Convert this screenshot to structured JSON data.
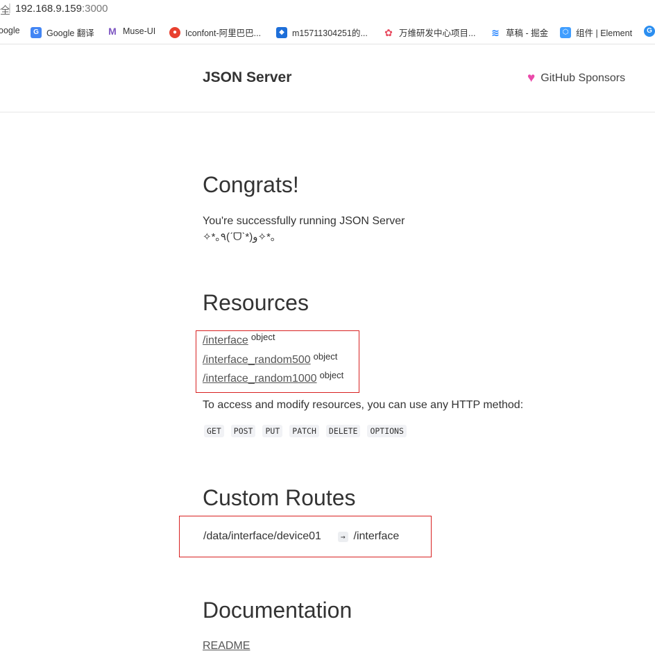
{
  "browser": {
    "security_label": "全",
    "url_host": "192.168.9.159",
    "url_port": ":3000",
    "bookmarks": [
      {
        "label": "oogle",
        "icon": "google-icon",
        "color": "#4285f4"
      },
      {
        "label": "Google 翻译",
        "icon": "google-translate-icon",
        "color": "#4285f4"
      },
      {
        "label": "Muse-UI",
        "icon": "muse-ui-icon",
        "color": "#7e57c2"
      },
      {
        "label": "Iconfont-阿里巴巴...",
        "icon": "iconfont-icon",
        "color": "#e8402f"
      },
      {
        "label": "m15711304251的...",
        "icon": "bookmark-app-icon",
        "color": "#1e6fd9"
      },
      {
        "label": "万维研发中心项目...",
        "icon": "flower-icon",
        "color": "#e84a5f"
      },
      {
        "label": "草稿 - 掘金",
        "icon": "juejin-icon",
        "color": "#1e80ff"
      },
      {
        "label": "组件 | Element",
        "icon": "element-icon",
        "color": "#409eff"
      }
    ]
  },
  "header": {
    "brand": "JSON Server",
    "sponsor": "GitHub Sponsors",
    "heart_color": "#ea4aaa"
  },
  "congrats": {
    "title": "Congrats!",
    "line1": "You're successfully running JSON Server",
    "line2": "✧*｡٩(ˊᗜˋ*)و✧*｡"
  },
  "resources": {
    "title": "Resources",
    "items": [
      {
        "name": "/interface",
        "type": "object"
      },
      {
        "name": "/interface_random500",
        "type": "object"
      },
      {
        "name": "/interface_random1000",
        "type": "object"
      }
    ],
    "access_text": "To access and modify resources, you can use any HTTP method:",
    "methods": [
      "GET",
      "POST",
      "PUT",
      "PATCH",
      "DELETE",
      "OPTIONS"
    ]
  },
  "custom_routes": {
    "title": "Custom Routes",
    "from": "/data/interface/device01",
    "arrow": "→",
    "to": "/interface"
  },
  "documentation": {
    "title": "Documentation",
    "link": "README"
  },
  "annotation_color": "#d82020"
}
